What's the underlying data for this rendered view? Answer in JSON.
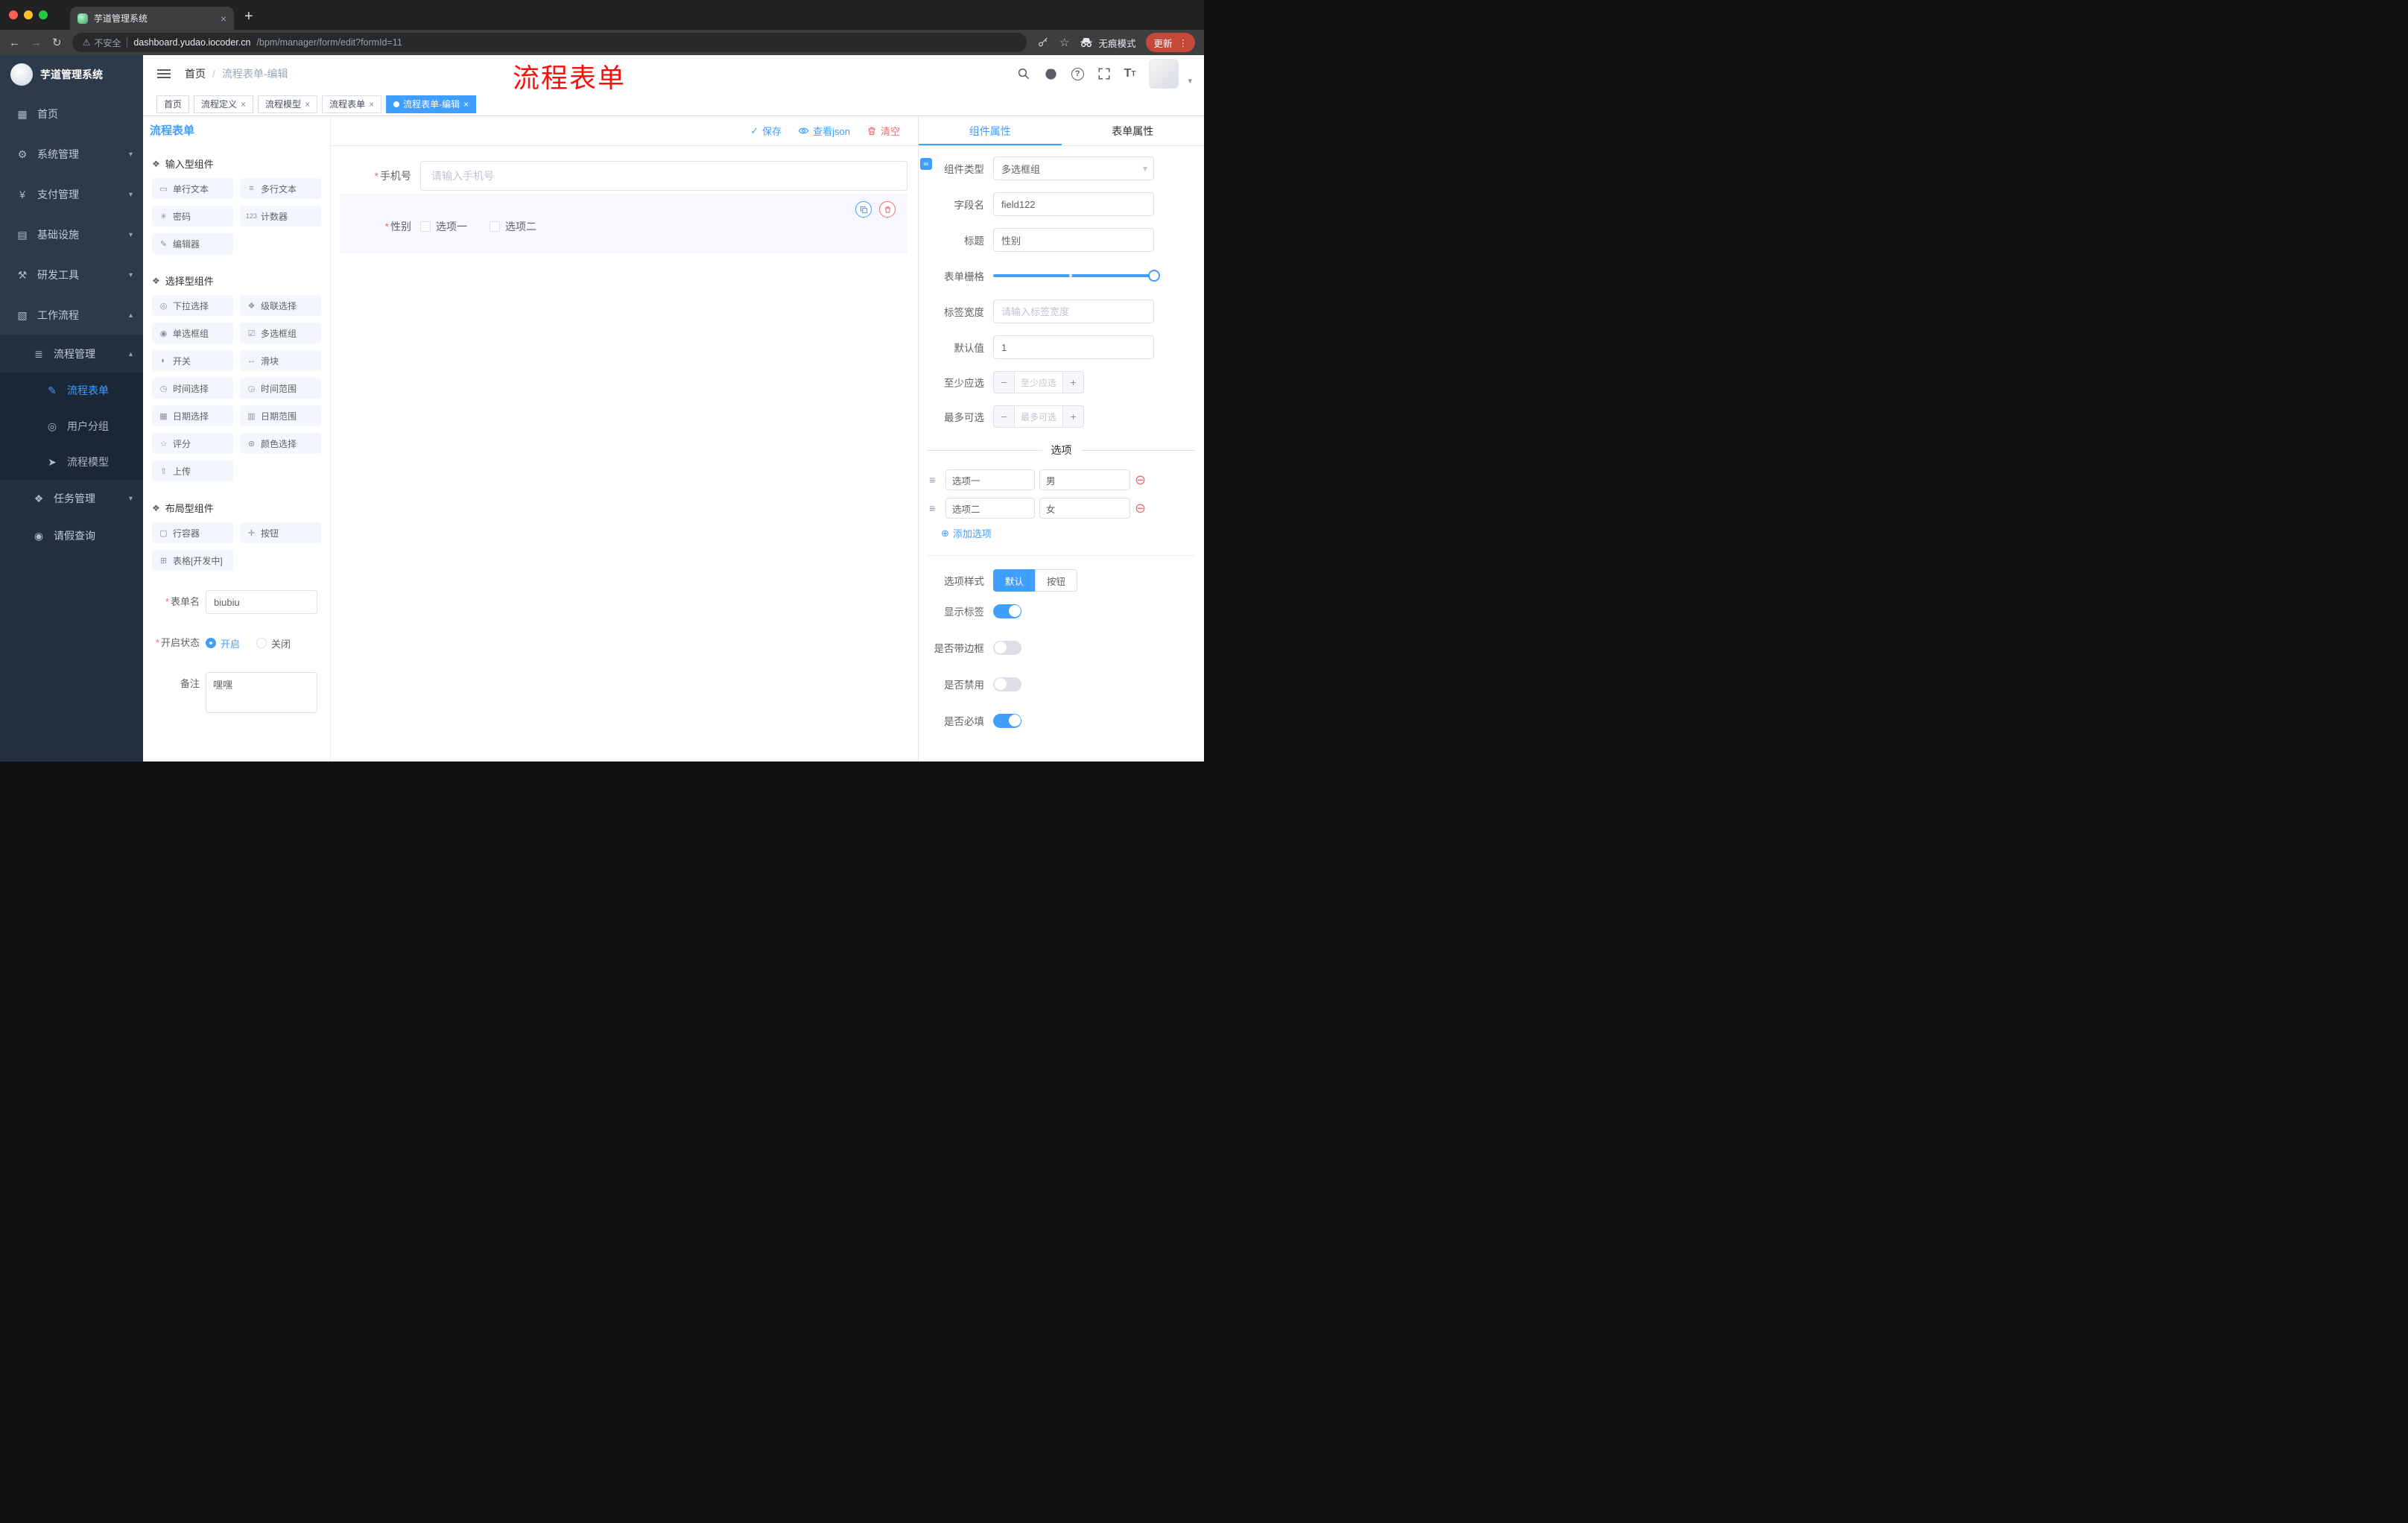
{
  "ui": {
    "close": "×",
    "menu_dots": "⋮",
    "new_tab": "+",
    "caret_down": "▾",
    "warning": "⚠",
    "back": "←",
    "forward": "→",
    "reload": "↻",
    "breadcrumb_sep": "/",
    "required_mark": "*",
    "minus": "−",
    "plus": "+",
    "star": "☆",
    "help_glyph": "?",
    "font_big": "T",
    "font_small": "T",
    "add_circle": "⊕",
    "remove_circle": "⊖",
    "drag_glyph": "≡",
    "link_glyph": "∞",
    "check": "✓"
  },
  "colors": {
    "accent": "#409eff",
    "danger": "#f56c6c",
    "annotation_red": "#ff0000",
    "update_pill": "#c5493a",
    "sidebar_bg": "#2d3a4b",
    "selected_widget_bg": "#f6f7ff"
  },
  "browser": {
    "tab_title": "芋道管理系统",
    "security_label": "不安全",
    "url_domain": "dashboard.yudao.iocoder.cn",
    "url_path": "/bpm/manager/form/edit?formId=11",
    "incognito_label": "无痕模式",
    "update_label": "更新"
  },
  "sidebar": {
    "logo_title": "芋道管理系统",
    "items": [
      {
        "label": "首页",
        "icon": "▦"
      },
      {
        "label": "系统管理",
        "icon": "⚙",
        "chevron": "▾"
      },
      {
        "label": "支付管理",
        "icon": "¥",
        "chevron": "▾"
      },
      {
        "label": "基础设施",
        "icon": "▤",
        "chevron": "▾"
      },
      {
        "label": "研发工具",
        "icon": "⚒",
        "chevron": "▾"
      },
      {
        "label": "工作流程",
        "icon": "▧",
        "chevron": "▴"
      },
      {
        "label": "流程管理",
        "icon": "≣",
        "chevron": "▴"
      },
      {
        "label": "流程表单",
        "icon": "✎",
        "active": true
      },
      {
        "label": "用户分组",
        "icon": "◎"
      },
      {
        "label": "流程模型",
        "icon": "➤"
      },
      {
        "label": "任务管理",
        "icon": "❖",
        "chevron": "▾"
      },
      {
        "label": "请假查询",
        "icon": "◉"
      }
    ]
  },
  "header": {
    "breadcrumb_home": "首页",
    "breadcrumb_current": "流程表单-编辑",
    "annotation": "流程表单"
  },
  "tagsview": [
    {
      "label": "首页",
      "closable": false,
      "active": false
    },
    {
      "label": "流程定义",
      "closable": true,
      "active": false
    },
    {
      "label": "流程模型",
      "closable": true,
      "active": false
    },
    {
      "label": "流程表单",
      "closable": true,
      "active": false
    },
    {
      "label": "流程表单-编辑",
      "closable": true,
      "active": true
    }
  ],
  "palette": {
    "title": "流程表单",
    "groups": [
      {
        "title": "输入型组件",
        "items": [
          {
            "label": "单行文本",
            "icon": "▭"
          },
          {
            "label": "多行文本",
            "icon": "≡"
          },
          {
            "label": "密码",
            "icon": "✳"
          },
          {
            "label": "计数器",
            "icon": "123"
          },
          {
            "label": "编辑器",
            "icon": "✎"
          }
        ]
      },
      {
        "title": "选择型组件",
        "items": [
          {
            "label": "下拉选择",
            "icon": "◎"
          },
          {
            "label": "级联选择",
            "icon": "❖"
          },
          {
            "label": "单选框组",
            "icon": "◉"
          },
          {
            "label": "多选框组",
            "icon": "☑"
          },
          {
            "label": "开关",
            "icon": "◐"
          },
          {
            "label": "滑块",
            "icon": "↔"
          },
          {
            "label": "时间选择",
            "icon": "◷"
          },
          {
            "label": "时间范围",
            "icon": "◶"
          },
          {
            "label": "日期选择",
            "icon": "▦"
          },
          {
            "label": "日期范围",
            "icon": "▥"
          },
          {
            "label": "评分",
            "icon": "☆"
          },
          {
            "label": "颜色选择",
            "icon": "⊛"
          },
          {
            "label": "上传",
            "icon": "⇧"
          }
        ]
      },
      {
        "title": "布局型组件",
        "items": [
          {
            "label": "行容器",
            "icon": "▢"
          },
          {
            "label": "按钮",
            "icon": "✛"
          },
          {
            "label": "表格[开发中]",
            "icon": "⊞"
          }
        ]
      }
    ],
    "form": {
      "name_label": "表单名",
      "name_value": "biubiu",
      "status_label": "开启状态",
      "status_on": "开启",
      "status_off": "关闭",
      "remark_label": "备注",
      "remark_value": "嘿嘿"
    }
  },
  "canvas": {
    "save": "保存",
    "view_json": "查看json",
    "clear": "清空",
    "phone_label": "手机号",
    "phone_placeholder": "请输入手机号",
    "gender_label": "性别",
    "gender_options": [
      "选项一",
      "选项二"
    ]
  },
  "props": {
    "tab_component": "组件属性",
    "tab_form": "表单属性",
    "component_type_label": "组件类型",
    "component_type_value": "多选框组",
    "field_name_label": "字段名",
    "field_name_value": "field122",
    "title_label": "标题",
    "title_value": "性别",
    "grid_label": "表单栅格",
    "label_width_label": "标签宽度",
    "label_width_placeholder": "请输入标签宽度",
    "default_label": "默认值",
    "default_value": "1",
    "min_label": "至少应选",
    "min_placeholder": "至少应选",
    "max_label": "最多可选",
    "max_placeholder": "最多可选",
    "options_title": "选项",
    "options": [
      {
        "label": "选项一",
        "value": "男"
      },
      {
        "label": "选项二",
        "value": "女"
      }
    ],
    "add_option": "添加选项",
    "style_label": "选项样式",
    "style_default": "默认",
    "style_button": "按钮",
    "switches": [
      {
        "label": "显示标签",
        "on": true
      },
      {
        "label": "是否带边框",
        "on": false
      },
      {
        "label": "是否禁用",
        "on": false
      },
      {
        "label": "是否必填",
        "on": true
      }
    ]
  }
}
